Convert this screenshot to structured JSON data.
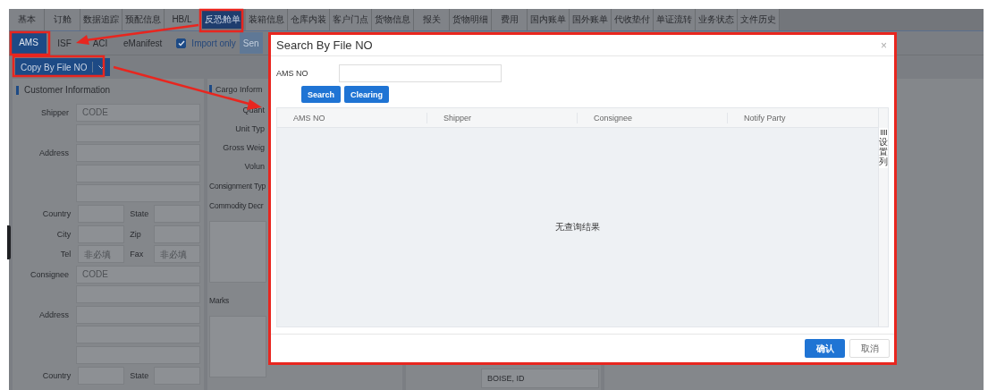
{
  "top_tabs": [
    {
      "label": "基本",
      "selected": false
    },
    {
      "label": "订舱",
      "selected": false
    },
    {
      "label": "数据追踪",
      "selected": false
    },
    {
      "label": "预配信息",
      "selected": false
    },
    {
      "label": "HB/L",
      "selected": false
    },
    {
      "label": "反恐舱单",
      "selected": true
    },
    {
      "label": "装箱信息",
      "selected": false
    },
    {
      "label": "仓库内装",
      "selected": false
    },
    {
      "label": "客户门点",
      "selected": false
    },
    {
      "label": "货物信息",
      "selected": false
    },
    {
      "label": "报关",
      "selected": false
    },
    {
      "label": "货物明细",
      "selected": false
    },
    {
      "label": "费用",
      "selected": false
    },
    {
      "label": "国内账单",
      "selected": false
    },
    {
      "label": "国外账单",
      "selected": false
    },
    {
      "label": "代收垫付",
      "selected": false
    },
    {
      "label": "单证流转",
      "selected": false
    },
    {
      "label": "业务状态",
      "selected": false
    },
    {
      "label": "文件历史",
      "selected": false
    }
  ],
  "sub_tabs": [
    {
      "label": "AMS",
      "selected": true
    },
    {
      "label": "ISF",
      "selected": false
    },
    {
      "label": "ACI",
      "selected": false
    },
    {
      "label": "eManifest",
      "selected": false
    }
  ],
  "import_only": {
    "label": "Import only",
    "checked": true
  },
  "send_button": {
    "label": "Sen"
  },
  "copy_button": {
    "label": "Copy By File NO"
  },
  "customer_info": {
    "title": "Customer Information",
    "rows": [
      {
        "kind": "single",
        "label": "Shipper",
        "placeholder": "CODE"
      },
      {
        "kind": "single"
      },
      {
        "kind": "single",
        "label": "Address"
      },
      {
        "kind": "single"
      },
      {
        "kind": "single"
      },
      {
        "kind": "pair",
        "fields": [
          {
            "label": "Country"
          },
          {
            "label": "State"
          }
        ]
      },
      {
        "kind": "pair",
        "fields": [
          {
            "label": "City"
          },
          {
            "label": "Zip"
          }
        ]
      },
      {
        "kind": "pair",
        "fields": [
          {
            "label": "Tel",
            "placeholder": "非必填"
          },
          {
            "label": "Fax",
            "placeholder": "非必填"
          }
        ]
      },
      {
        "kind": "single",
        "label": "Consignee",
        "placeholder": "CODE"
      },
      {
        "kind": "single"
      },
      {
        "kind": "single",
        "label": "Address"
      },
      {
        "kind": "single"
      },
      {
        "kind": "single"
      },
      {
        "kind": "pair",
        "fields": [
          {
            "label": "Country"
          },
          {
            "label": "State"
          }
        ]
      }
    ]
  },
  "cargo_info": {
    "title": "Cargo Inform",
    "rows": [
      {
        "kind": "right",
        "label": "Quant"
      },
      {
        "kind": "right",
        "label": "Unit Typ"
      },
      {
        "kind": "right",
        "label": "Gross Weig"
      },
      {
        "kind": "right",
        "label": "Volun"
      },
      {
        "kind": "left",
        "label": "Consignment Typ"
      },
      {
        "kind": "left",
        "label": "Commodity Decr"
      },
      {
        "kind": "textarea"
      },
      {
        "kind": "left",
        "label": "Marks"
      },
      {
        "kind": "textarea"
      }
    ]
  },
  "address_panel": {
    "value": "BOISE, ID"
  },
  "modal": {
    "title": "Search By File NO",
    "close": "×",
    "field": {
      "label": "AMS NO"
    },
    "buttons": [
      {
        "label": "Search"
      },
      {
        "label": "Clearing"
      }
    ],
    "columns": [
      "AMS NO",
      "Shipper",
      "Consignee",
      "Notify Party"
    ],
    "column_settings": "设置列",
    "empty_text": "无查询结果",
    "footer_buttons": [
      {
        "label": "确认",
        "kind": "primary"
      },
      {
        "label": "取消",
        "kind": "default"
      }
    ]
  }
}
